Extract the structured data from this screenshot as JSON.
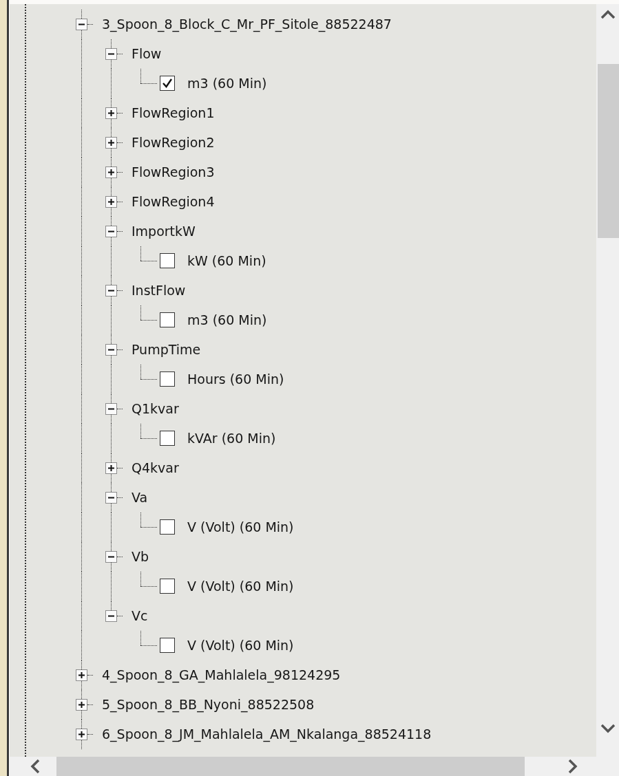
{
  "tree": {
    "nodes": [
      {
        "kind": "group",
        "label": "3_Spoon_8_Block_C_Mr_PF_Sitole_88522487",
        "expanded": true,
        "children": [
          {
            "kind": "group",
            "label": "Flow",
            "expanded": true,
            "children": [
              {
                "kind": "leaf",
                "label": "m3 (60 Min)",
                "checked": true
              }
            ]
          },
          {
            "kind": "group",
            "label": "FlowRegion1",
            "expanded": false
          },
          {
            "kind": "group",
            "label": "FlowRegion2",
            "expanded": false
          },
          {
            "kind": "group",
            "label": "FlowRegion3",
            "expanded": false
          },
          {
            "kind": "group",
            "label": "FlowRegion4",
            "expanded": false
          },
          {
            "kind": "group",
            "label": "ImportkW",
            "expanded": true,
            "children": [
              {
                "kind": "leaf",
                "label": "kW (60 Min)",
                "checked": false
              }
            ]
          },
          {
            "kind": "group",
            "label": "InstFlow",
            "expanded": true,
            "children": [
              {
                "kind": "leaf",
                "label": "m3 (60 Min)",
                "checked": false
              }
            ]
          },
          {
            "kind": "group",
            "label": "PumpTime",
            "expanded": true,
            "children": [
              {
                "kind": "leaf",
                "label": "Hours (60 Min)",
                "checked": false
              }
            ]
          },
          {
            "kind": "group",
            "label": "Q1kvar",
            "expanded": true,
            "children": [
              {
                "kind": "leaf",
                "label": "kVAr (60 Min)",
                "checked": false
              }
            ]
          },
          {
            "kind": "group",
            "label": "Q4kvar",
            "expanded": false
          },
          {
            "kind": "group",
            "label": "Va",
            "expanded": true,
            "children": [
              {
                "kind": "leaf",
                "label": "V (Volt) (60 Min)",
                "checked": false
              }
            ]
          },
          {
            "kind": "group",
            "label": "Vb",
            "expanded": true,
            "children": [
              {
                "kind": "leaf",
                "label": "V (Volt) (60 Min)",
                "checked": false
              }
            ]
          },
          {
            "kind": "group",
            "label": "Vc",
            "expanded": true,
            "children": [
              {
                "kind": "leaf",
                "label": "V (Volt) (60 Min)",
                "checked": false
              }
            ]
          }
        ]
      },
      {
        "kind": "group",
        "label": "4_Spoon_8_GA_Mahlalela_98124295",
        "expanded": false
      },
      {
        "kind": "group",
        "label": "5_Spoon_8_BB_Nyoni_88522508",
        "expanded": false
      },
      {
        "kind": "group",
        "label": "6_Spoon_8_JM_Mahlalela_AM_Nkalanga_88524118",
        "expanded": false
      }
    ]
  }
}
